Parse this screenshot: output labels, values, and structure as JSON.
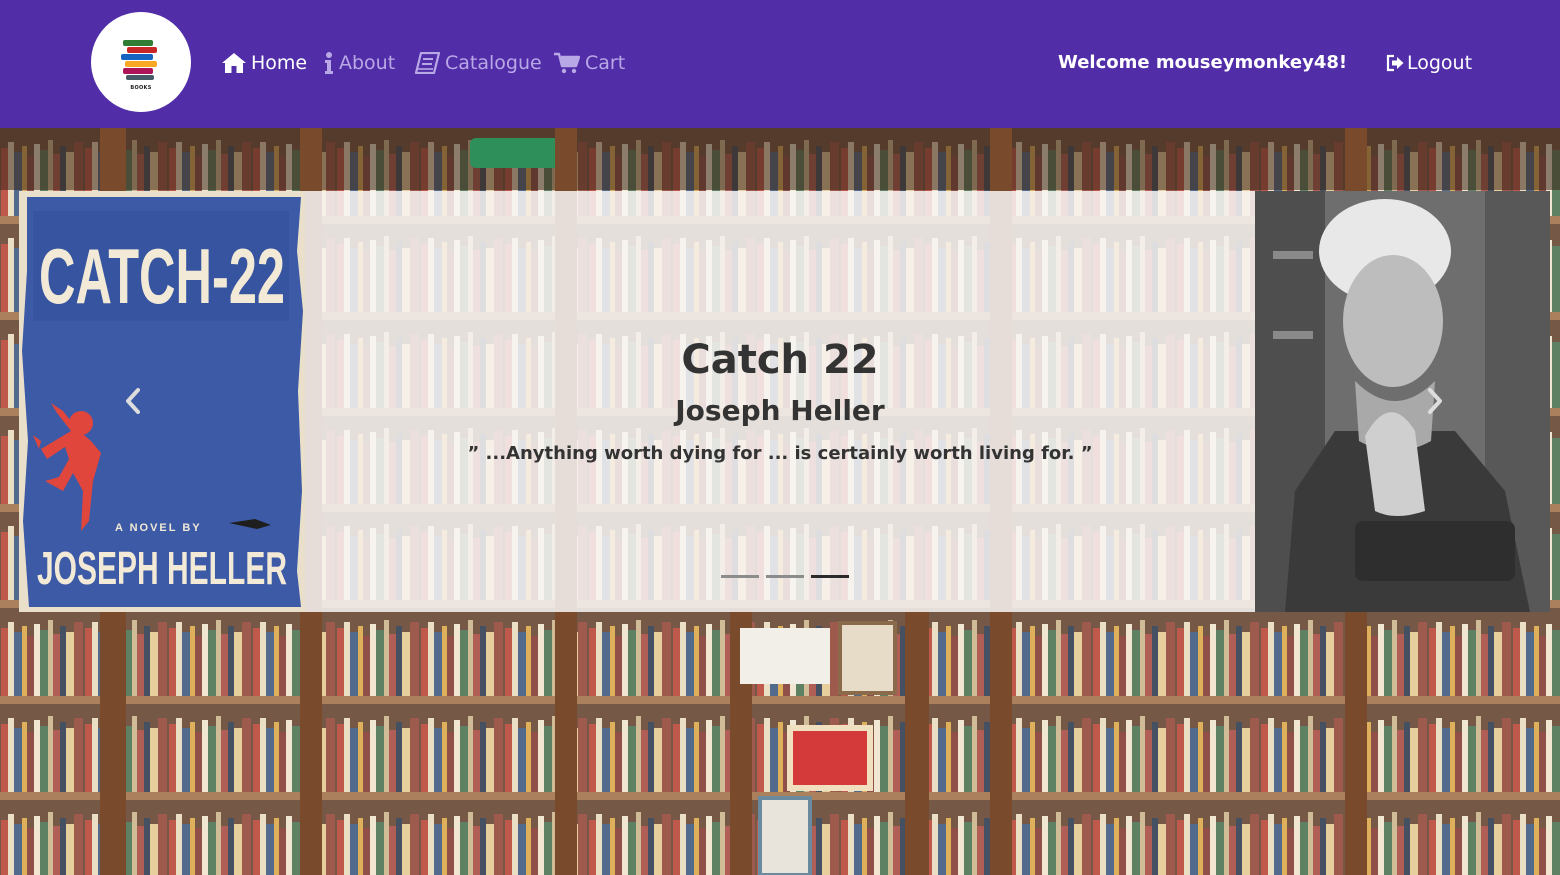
{
  "nav": {
    "logo_text": "BOOKS",
    "items": [
      {
        "label": "Home",
        "icon": "home-icon",
        "active": true
      },
      {
        "label": "About",
        "icon": "info-icon",
        "active": false
      },
      {
        "label": "Catalogue",
        "icon": "book-icon",
        "active": false
      },
      {
        "label": "Cart",
        "icon": "cart-icon",
        "active": false
      }
    ],
    "welcome": "Welcome mouseymonkey48!",
    "logout": "Logout"
  },
  "carousel": {
    "title": "Catch 22",
    "author": "Joseph Heller",
    "quote": "” ...Anything worth dying for ... is certainly worth living for. ”",
    "cover": {
      "title": "CATCH-22",
      "byline": "A NOVEL BY",
      "author": "JOSEPH HELLER"
    },
    "slide_count": 3,
    "active_index": 2,
    "controls": [
      "chevron-left-icon",
      "chevron-right-icon"
    ]
  },
  "colors": {
    "navbar": "#512da8",
    "nav_active": "#ffffff",
    "nav_inactive": "#b9a8e6",
    "caption_text": "#333333",
    "cover_blue": "#3c5aa6",
    "cover_red": "#e0463c"
  }
}
